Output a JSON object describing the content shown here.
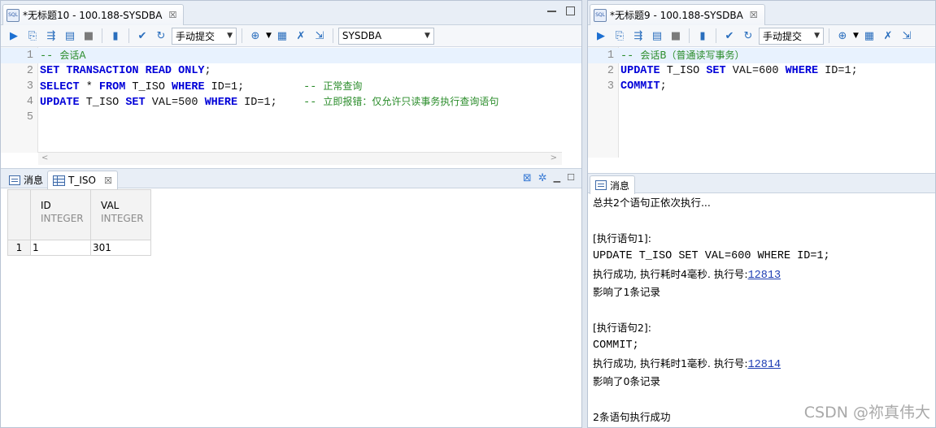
{
  "left": {
    "tab_title": "*无标题10 - 100.188-SYSDBA",
    "commit_mode": "手动提交",
    "schema": "SYSDBA",
    "editor_lines": [
      {
        "n": "1",
        "parts": [
          {
            "t": "-- ",
            "c": "cm"
          },
          {
            "t": "会话A",
            "c": "cmz"
          }
        ]
      },
      {
        "n": "2",
        "parts": [
          {
            "t": "SET TRANSACTION READ ONLY",
            "c": "kw"
          },
          {
            "t": ";",
            "c": "pl"
          }
        ]
      },
      {
        "n": "3",
        "parts": [
          {
            "t": "SELECT",
            "c": "kw"
          },
          {
            "t": " * ",
            "c": "pl"
          },
          {
            "t": "FROM",
            "c": "kw"
          },
          {
            "t": " T_ISO ",
            "c": "pl"
          },
          {
            "t": "WHERE",
            "c": "kw"
          },
          {
            "t": " ID=1;         ",
            "c": "pl"
          },
          {
            "t": "-- ",
            "c": "cm"
          },
          {
            "t": "正常查询",
            "c": "cmz"
          }
        ]
      },
      {
        "n": "4",
        "parts": [
          {
            "t": "UPDATE",
            "c": "kw"
          },
          {
            "t": " T_ISO ",
            "c": "pl"
          },
          {
            "t": "SET",
            "c": "kw"
          },
          {
            "t": " VAL=500 ",
            "c": "pl"
          },
          {
            "t": "WHERE",
            "c": "kw"
          },
          {
            "t": " ID=1;    ",
            "c": "pl"
          },
          {
            "t": "-- ",
            "c": "cm"
          },
          {
            "t": "立即报错：仅允许只读事务执行查询语句",
            "c": "cmz"
          }
        ]
      },
      {
        "n": "5",
        "parts": []
      }
    ],
    "result_tabs": {
      "messages": "消息",
      "table": "T_ISO"
    },
    "grid": {
      "columns": [
        {
          "name": "ID",
          "type": "INTEGER"
        },
        {
          "name": "VAL",
          "type": "INTEGER"
        }
      ],
      "rows": [
        {
          "rownum": "1",
          "cells": [
            "1",
            "301"
          ]
        }
      ]
    }
  },
  "right": {
    "tab_title": "*无标题9 - 100.188-SYSDBA",
    "commit_mode": "手动提交",
    "editor_lines": [
      {
        "n": "1",
        "parts": [
          {
            "t": "-- ",
            "c": "cm"
          },
          {
            "t": "会话B（普通读写事务）",
            "c": "cmz"
          }
        ]
      },
      {
        "n": "2",
        "parts": [
          {
            "t": "UPDATE",
            "c": "kw"
          },
          {
            "t": " T_ISO ",
            "c": "pl"
          },
          {
            "t": "SET",
            "c": "kw"
          },
          {
            "t": " VAL=600 ",
            "c": "pl"
          },
          {
            "t": "WHERE",
            "c": "kw"
          },
          {
            "t": " ID=1;",
            "c": "pl"
          }
        ]
      },
      {
        "n": "3",
        "parts": [
          {
            "t": "COMMIT",
            "c": "kw"
          },
          {
            "t": ";",
            "c": "pl"
          }
        ]
      }
    ],
    "result_tabs": {
      "messages": "消息"
    },
    "messages": {
      "summary": "总共2个语句正依次执行...",
      "stmt1_header": "[执行语句1]:",
      "stmt1_sql": "UPDATE T_ISO SET VAL=600 WHERE ID=1;",
      "stmt1_result": "执行成功, 执行耗时4毫秒. 执行号:",
      "stmt1_id": "12813",
      "stmt1_rows": "影响了1条记录",
      "stmt2_header": "[执行语句2]:",
      "stmt2_sql": "COMMIT;",
      "stmt2_result": "执行成功, 执行耗时1毫秒. 执行号:",
      "stmt2_id": "12814",
      "stmt2_rows": "影响了0条记录",
      "final": "2条语句执行成功"
    }
  },
  "watermark": "CSDN @祢真伟大",
  "icons": [
    "sql-file-icon",
    "execute-icon",
    "explain-icon",
    "format-icon",
    "save-icon",
    "stop-icon",
    "stats-icon",
    "commit-icon",
    "rollback-icon",
    "target-icon",
    "calendar-icon",
    "compile-icon",
    "debug-icon",
    "close-icon"
  ]
}
